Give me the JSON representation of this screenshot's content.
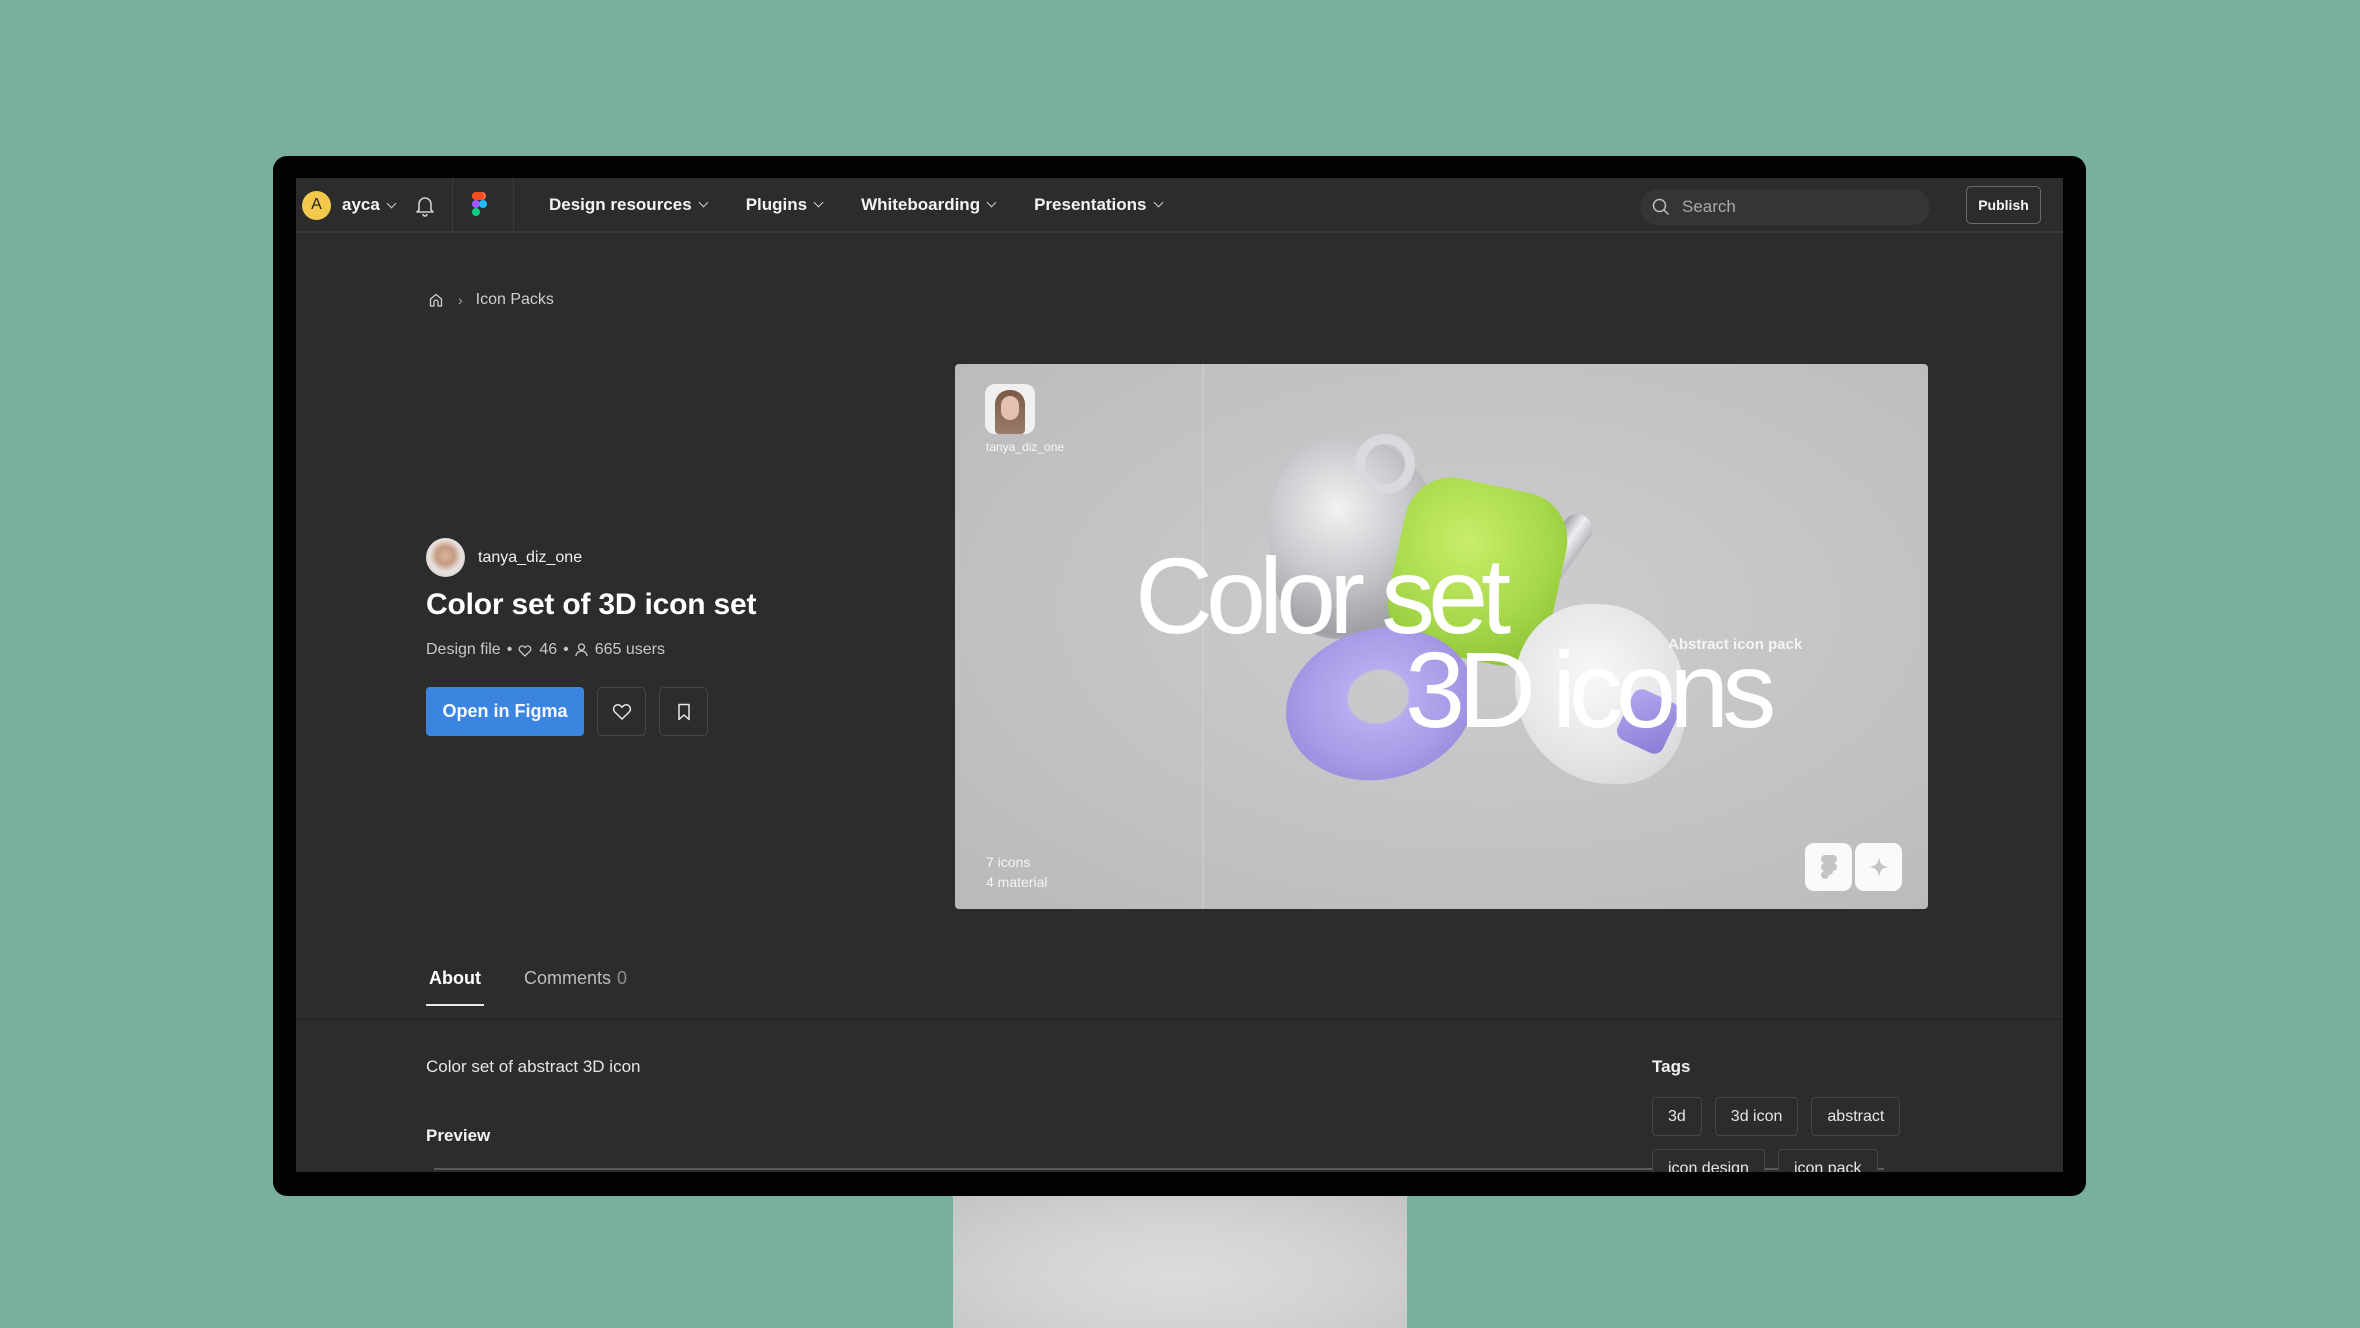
{
  "nav": {
    "user_initial": "A",
    "username": "ayca",
    "menu": [
      {
        "label": "Design resources"
      },
      {
        "label": "Plugins"
      },
      {
        "label": "Whiteboarding"
      },
      {
        "label": "Presentations"
      }
    ],
    "search_placeholder": "Search",
    "publish_label": "Publish"
  },
  "breadcrumb": {
    "items": [
      "Icon Packs"
    ]
  },
  "resource": {
    "author": "tanya_diz_one",
    "title": "Color set of 3D icon set",
    "type": "Design file",
    "likes": "46",
    "users": "665 users",
    "open_label": "Open in Figma"
  },
  "preview_card": {
    "handle": "tanya_diz_one",
    "headline_line1": "Color set",
    "headline_line2": "3D icons",
    "subtitle": "Abstract icon pack",
    "count_line1": "7 icons",
    "count_line2": "4 material",
    "colors": {
      "lime": "#a6d84a",
      "lavender": "#a99be6",
      "chrome": "#d9dadd"
    }
  },
  "tabs": [
    {
      "label": "About",
      "active": true
    },
    {
      "label": "Comments",
      "count": "0"
    }
  ],
  "about": {
    "description": "Color set of abstract 3D icon",
    "preview_heading": "Preview",
    "tags_heading": "Tags",
    "tags": [
      "3d",
      "3d icon",
      "abstract",
      "icon design",
      "icon pack"
    ]
  },
  "theme": {
    "background": "#78b09c",
    "accent": "#3b85e0",
    "surface": "#2c2c2c"
  }
}
